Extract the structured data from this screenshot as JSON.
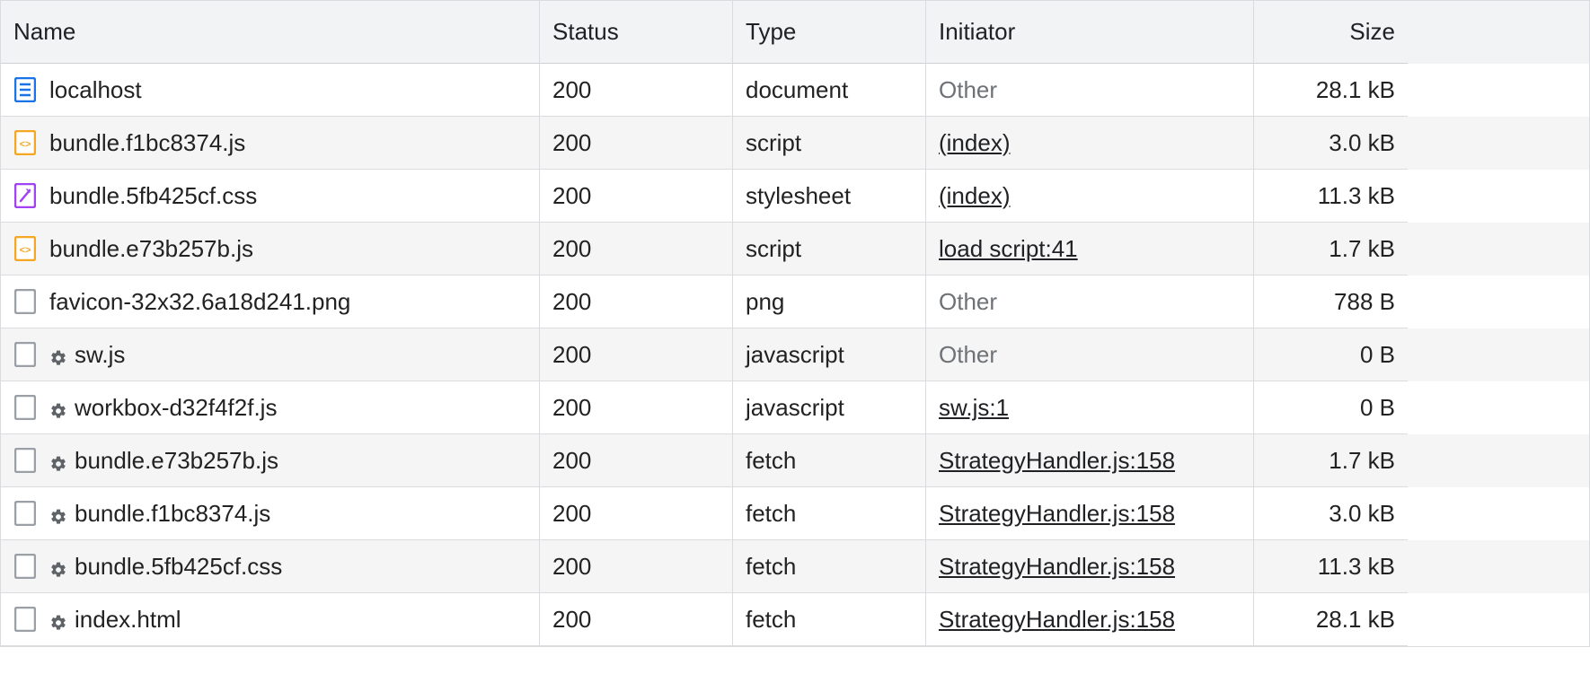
{
  "columns": {
    "name": "Name",
    "status": "Status",
    "type": "Type",
    "initiator": "Initiator",
    "size": "Size"
  },
  "rows": [
    {
      "icon": "document",
      "gear": false,
      "name": "localhost",
      "status": "200",
      "type": "document",
      "initiator": "Other",
      "initiator_link": false,
      "size": "28.1 kB"
    },
    {
      "icon": "js",
      "gear": false,
      "name": "bundle.f1bc8374.js",
      "status": "200",
      "type": "script",
      "initiator": "(index)",
      "initiator_link": true,
      "size": "3.0 kB"
    },
    {
      "icon": "css",
      "gear": false,
      "name": "bundle.5fb425cf.css",
      "status": "200",
      "type": "stylesheet",
      "initiator": "(index)",
      "initiator_link": true,
      "size": "11.3 kB"
    },
    {
      "icon": "js",
      "gear": false,
      "name": "bundle.e73b257b.js",
      "status": "200",
      "type": "script",
      "initiator": "load script:41",
      "initiator_link": true,
      "size": "1.7 kB"
    },
    {
      "icon": "blank",
      "gear": false,
      "name": "favicon-32x32.6a18d241.png",
      "status": "200",
      "type": "png",
      "initiator": "Other",
      "initiator_link": false,
      "size": "788 B"
    },
    {
      "icon": "blank",
      "gear": true,
      "name": "sw.js",
      "status": "200",
      "type": "javascript",
      "initiator": "Other",
      "initiator_link": false,
      "size": "0 B"
    },
    {
      "icon": "blank",
      "gear": true,
      "name": "workbox-d32f4f2f.js",
      "status": "200",
      "type": "javascript",
      "initiator": "sw.js:1",
      "initiator_link": true,
      "size": "0 B"
    },
    {
      "icon": "blank",
      "gear": true,
      "name": "bundle.e73b257b.js",
      "status": "200",
      "type": "fetch",
      "initiator": "StrategyHandler.js:158",
      "initiator_link": true,
      "size": "1.7 kB"
    },
    {
      "icon": "blank",
      "gear": true,
      "name": "bundle.f1bc8374.js",
      "status": "200",
      "type": "fetch",
      "initiator": "StrategyHandler.js:158",
      "initiator_link": true,
      "size": "3.0 kB"
    },
    {
      "icon": "blank",
      "gear": true,
      "name": "bundle.5fb425cf.css",
      "status": "200",
      "type": "fetch",
      "initiator": "StrategyHandler.js:158",
      "initiator_link": true,
      "size": "11.3 kB"
    },
    {
      "icon": "blank",
      "gear": true,
      "name": "index.html",
      "status": "200",
      "type": "fetch",
      "initiator": "StrategyHandler.js:158",
      "initiator_link": true,
      "size": "28.1 kB"
    }
  ]
}
